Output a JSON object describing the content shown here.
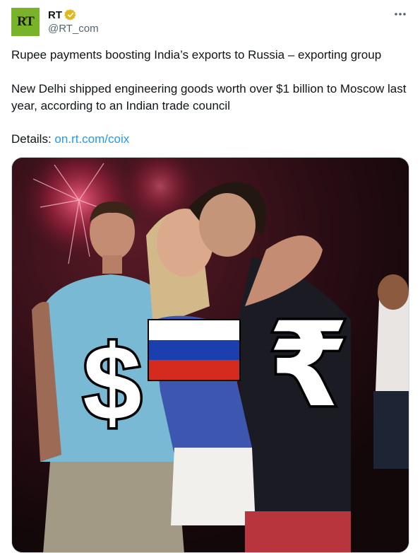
{
  "header": {
    "avatar_text": "RT",
    "display_name": "RT",
    "handle": "@RT_com",
    "verified_icon": "verified-badge-icon",
    "more_icon": "more-options-icon"
  },
  "body": {
    "line1": "Rupee payments boosting India’s exports to Russia – exporting group",
    "line2": "New Delhi shipped engineering goods worth over $1 billion to Moscow last year, according to an Indian trade council",
    "details_label": "Details: ",
    "details_link": "on.rt.com/coix"
  },
  "media": {
    "symbols": {
      "dollar": "$",
      "rupee": "₹"
    },
    "flag_colors": [
      "#ffffff",
      "#1c3fb0",
      "#d52b1e"
    ]
  },
  "colors": {
    "accent": "#1d9bf0",
    "rt_green": "#79b32a",
    "verified_gold": "#e2b719",
    "muted_text": "#536471"
  }
}
